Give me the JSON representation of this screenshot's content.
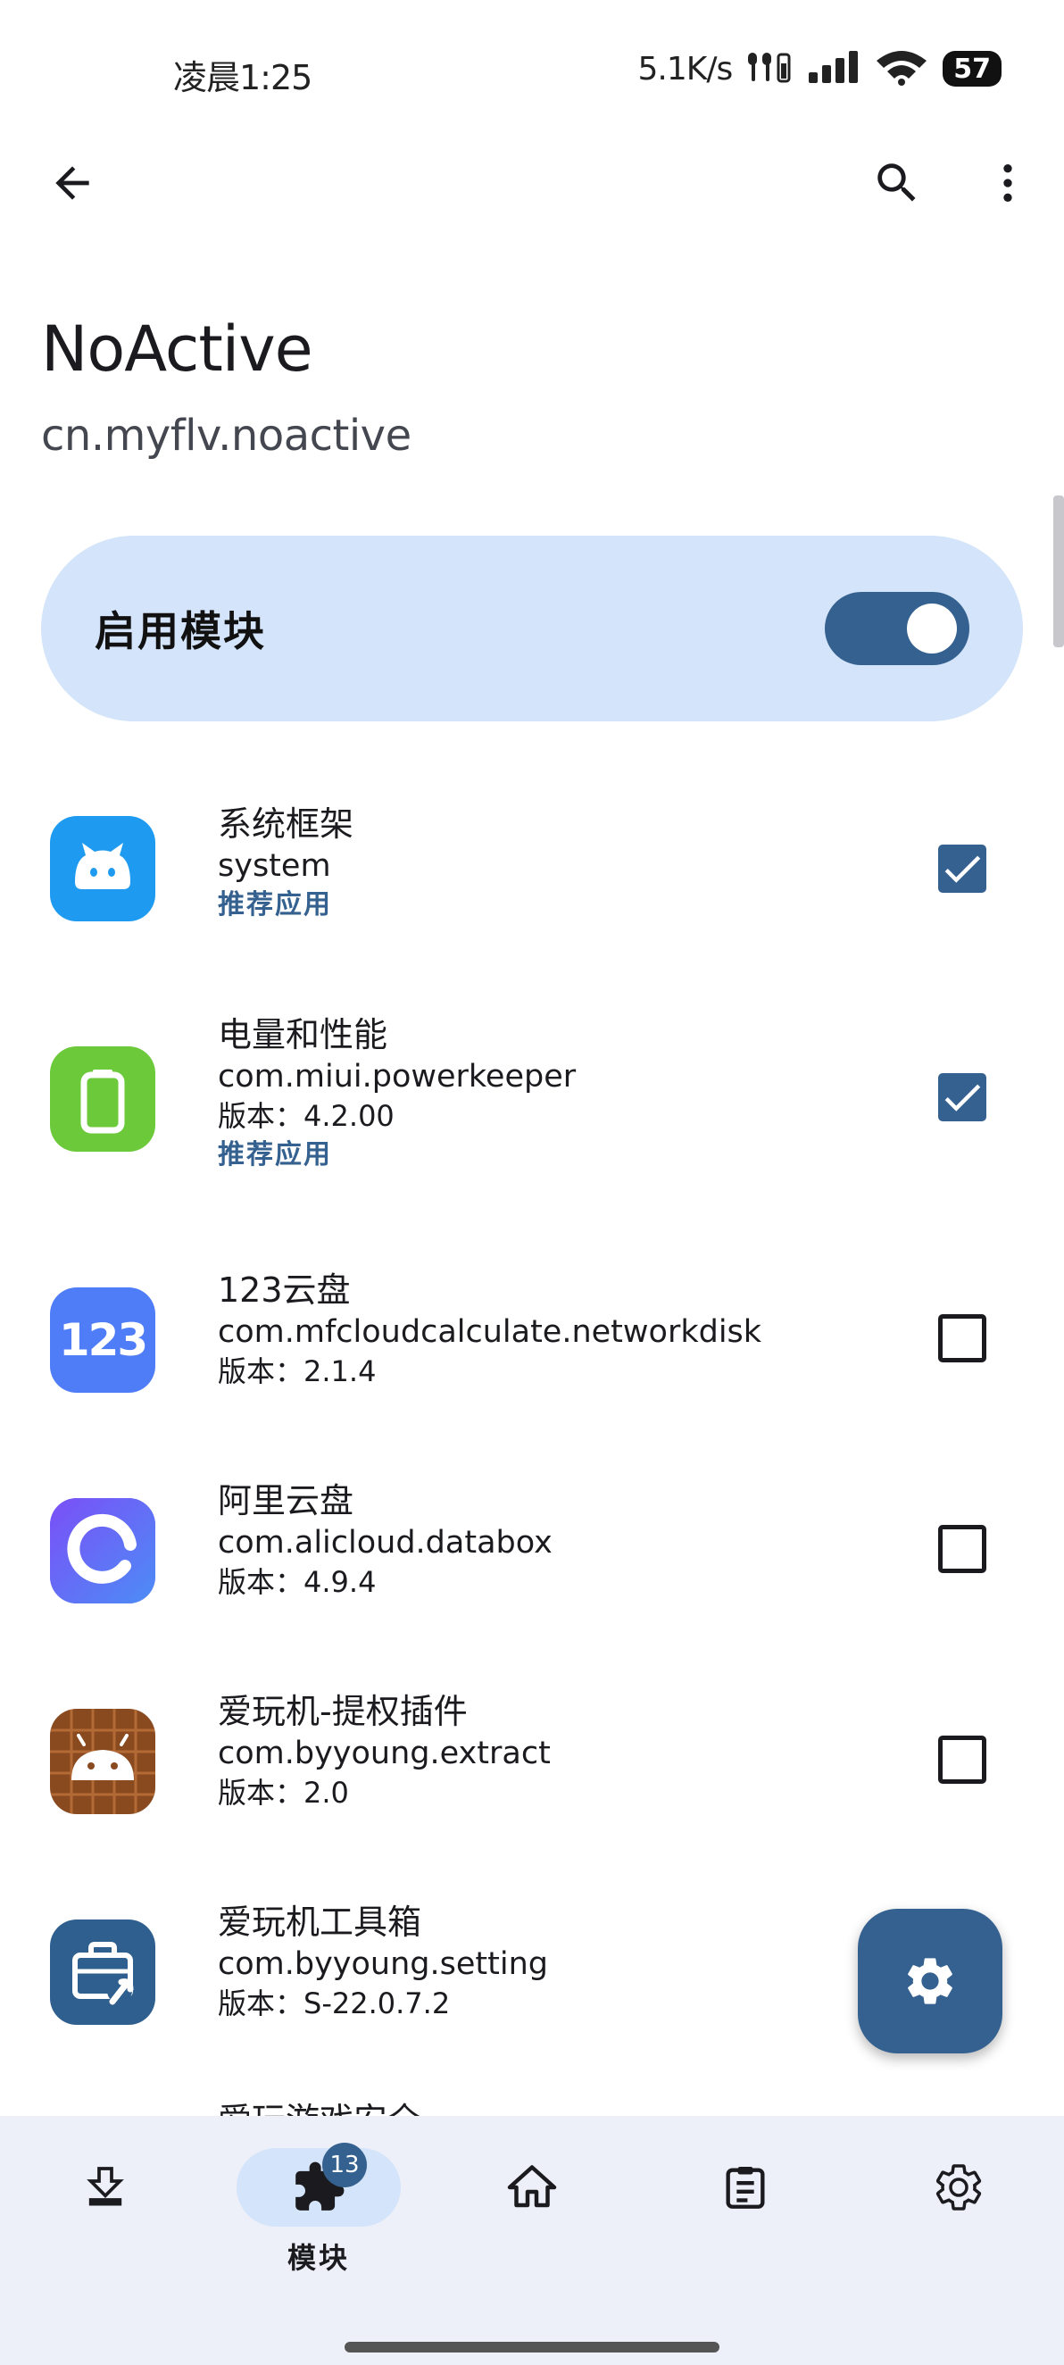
{
  "status_bar": {
    "time": "凌晨1:25",
    "net_speed": "5.1K/s",
    "battery": "57"
  },
  "app_bar": {
    "back_icon": "arrow-back-icon",
    "search_icon": "search-icon",
    "more_icon": "more-vert-icon"
  },
  "module": {
    "title": "NoActive",
    "package": "cn.myflv.noactive"
  },
  "enable_card": {
    "label": "启用模块",
    "enabled": true
  },
  "apps": [
    {
      "name": "系统框架",
      "package": "system",
      "version": "",
      "tag": "推荐应用",
      "checked": true,
      "icon": "system-framework-icon",
      "icon_color": "#1e9bf0"
    },
    {
      "name": "电量和性能",
      "package": "com.miui.powerkeeper",
      "version": "版本：4.2.00",
      "tag": "推荐应用",
      "checked": true,
      "icon": "battery-icon",
      "icon_color": "#6cc93a"
    },
    {
      "name": "123云盘",
      "package": "com.mfcloudcalculate.networkdisk",
      "version": "版本：2.1.4",
      "tag": "",
      "checked": false,
      "icon": "pan123-icon",
      "icon_color": "#4f7cf7",
      "icon_text": "123"
    },
    {
      "name": "阿里云盘",
      "package": "com.alicloud.databox",
      "version": "版本：4.9.4",
      "tag": "",
      "checked": false,
      "icon": "aliyun-drive-icon",
      "icon_color": "#5a62f0"
    },
    {
      "name": "爱玩机-提权插件",
      "package": "com.byyoung.extract",
      "version": "版本：2.0",
      "tag": "",
      "checked": false,
      "icon": "android-plugin-icon",
      "icon_color": "#8a4a20"
    },
    {
      "name": "爱玩机工具箱",
      "package": "com.byyoung.setting",
      "version": "版本：S-22.0.7.2",
      "tag": "",
      "checked": false,
      "icon": "toolbox-icon",
      "icon_color": "#2f5f8e"
    }
  ],
  "peek_item": {
    "name": "爱玩游戏安全"
  },
  "fab": {
    "icon": "settings-gear-icon"
  },
  "bottom_nav": {
    "items": [
      {
        "id": "download",
        "icon": "download-icon",
        "label": ""
      },
      {
        "id": "modules",
        "icon": "puzzle-icon",
        "label": "模块",
        "badge": "13",
        "active": true
      },
      {
        "id": "home",
        "icon": "home-icon",
        "label": ""
      },
      {
        "id": "logs",
        "icon": "clipboard-icon",
        "label": ""
      },
      {
        "id": "settings",
        "icon": "settings-icon",
        "label": ""
      }
    ]
  },
  "colors": {
    "primary": "#34618f",
    "card_bg": "#d4e4fa",
    "nav_bg": "#eef0f9"
  }
}
